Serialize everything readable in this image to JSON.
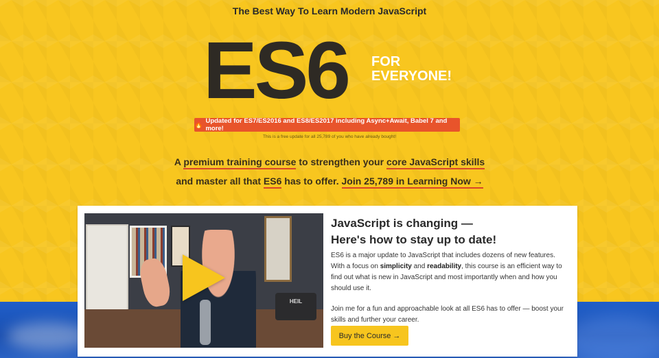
{
  "header": {
    "tagline": "The Best Way To Learn Modern JavaScript"
  },
  "logo": {
    "main": "ES6",
    "sub_line1": "FOR",
    "sub_line2": "EVERYONE!"
  },
  "update_banner": {
    "icon": "fire-icon",
    "icon_glyph": "🔥",
    "text": "Updated for ES7/ES2016 and ES8/ES2017 including Async+Await, Babel 7 and more!",
    "note": "This is a free update for all 25,789 of you who have already bought!"
  },
  "pitch": {
    "line1_a": "A",
    "line1_b": "premium training course",
    "line1_c": "to strengthen your",
    "line1_d": "core JavaScript skills",
    "line2_a": "and master all that",
    "line2_b": "ES6",
    "line2_c": "has to offer.",
    "line2_link": "Join 25,789 in Learning Now →"
  },
  "video": {
    "mic_label": "HEIL"
  },
  "card": {
    "title_line1": "JavaScript is changing —",
    "title_line2": "Here's how to stay up to date!",
    "p1_a": "ES6 is a major update to JavaScript that includes dozens of new features. With a focus on",
    "p1_b": "simplicity",
    "p1_c": "and",
    "p1_d": "readability",
    "p1_e": ", this course is an efficient way to find out what is new in JavaScript and most importantly when and how you should use it.",
    "p2": "Join me for a fun and approachable look at all ES6 has to offer — boost your skills and further your career.",
    "buy_label": "Buy the Course →"
  },
  "colors": {
    "background_yellow": "#f7c51e",
    "banner_orange": "#e8542b",
    "underline_red": "#d9452a",
    "dark_text": "#2e2a24",
    "band_blue": "#1f5ec9"
  }
}
